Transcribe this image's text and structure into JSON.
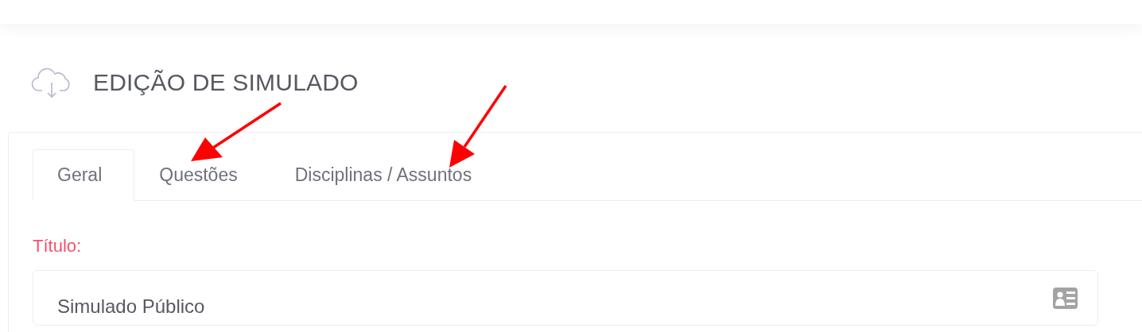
{
  "page_title": "EDIÇÃO DE SIMULADO",
  "tabs": [
    {
      "label": "Geral",
      "selected": true
    },
    {
      "label": "Questões",
      "selected": false
    },
    {
      "label": "Disciplinas / Assuntos",
      "selected": false
    }
  ],
  "form": {
    "label": "Título:",
    "value": "Simulado Público"
  }
}
